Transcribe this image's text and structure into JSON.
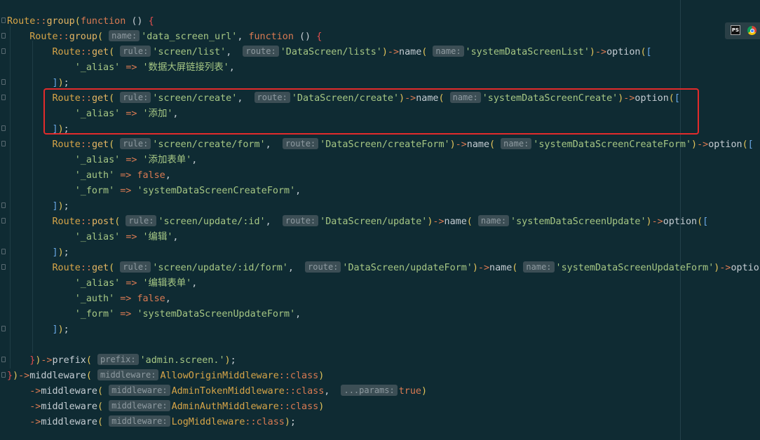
{
  "code": {
    "l1": {
      "a": "Route",
      "b": "::",
      "c": "group",
      "d": "function",
      "e": " () "
    },
    "l2": {
      "a": "Route",
      "b": "::",
      "c": "group",
      "hint": "name:",
      "s1": "'data_screen_url'",
      "d": "function",
      "e": " () "
    },
    "l3": {
      "a": "Route",
      "b": "::",
      "c": "get",
      "h1": "rule:",
      "s1": "'screen/list'",
      "h2": "route:",
      "s2": "'DataScreen/lists'",
      "m": "name",
      "h3": "name:",
      "s3": "'systemDataScreenList'",
      "o": "option"
    },
    "l4": {
      "k": "'_alias'",
      "arrow": "=>",
      "v": "'数据大屏链接列表'"
    },
    "l5": {
      "end": ";"
    },
    "l6": {
      "a": "Route",
      "b": "::",
      "c": "get",
      "h1": "rule:",
      "s1": "'screen/create'",
      "h2": "route:",
      "s2": "'DataScreen/create'",
      "m": "name",
      "h3": "name:",
      "s3": "'systemDataScreenCreate'",
      "o": "option"
    },
    "l7": {
      "k": "'_alias'",
      "arrow": "=>",
      "v": "'添加'"
    },
    "l9": {
      "a": "Route",
      "b": "::",
      "c": "get",
      "h1": "rule:",
      "s1": "'screen/create/form'",
      "h2": "route:",
      "s2": "'DataScreen/createForm'",
      "m": "name",
      "h3": "name:",
      "s3": "'systemDataScreenCreateForm'",
      "o": "option"
    },
    "l10": {
      "k": "'_alias'",
      "arrow": "=>",
      "v": "'添加表单'"
    },
    "l11": {
      "k": "'_auth'",
      "arrow": "=>",
      "v": "false"
    },
    "l12": {
      "k": "'_form'",
      "arrow": "=>",
      "v": "'systemDataScreenCreateForm'"
    },
    "l14": {
      "a": "Route",
      "b": "::",
      "c": "post",
      "h1": "rule:",
      "s1": "'screen/update/:id'",
      "h2": "route:",
      "s2": "'DataScreen/update'",
      "m": "name",
      "h3": "name:",
      "s3": "'systemDataScreenUpdate'",
      "o": "option"
    },
    "l15": {
      "k": "'_alias'",
      "arrow": "=>",
      "v": "'编辑'"
    },
    "l17": {
      "a": "Route",
      "b": "::",
      "c": "get",
      "h1": "rule:",
      "s1": "'screen/update/:id/form'",
      "h2": "route:",
      "s2": "'DataScreen/updateForm'",
      "m": "name",
      "h3": "name:",
      "s3": "'systemDataScreenUpdateForm'",
      "o": "option"
    },
    "l18": {
      "k": "'_alias'",
      "arrow": "=>",
      "v": "'编辑表单'"
    },
    "l19": {
      "k": "'_auth'",
      "arrow": "=>",
      "v": "false"
    },
    "l20": {
      "k": "'_form'",
      "arrow": "=>",
      "v": "'systemDataScreenUpdateForm'"
    },
    "l23": {
      "m": "prefix",
      "h": "prefix:",
      "s": "'admin.screen.'"
    },
    "l24": {
      "m": "middleware",
      "h": "middleware:",
      "c": "AllowOriginMiddleware",
      "d": "class"
    },
    "l25": {
      "m": "middleware",
      "h": "middleware:",
      "c": "AdminTokenMiddleware",
      "d": "class",
      "h2": "...params:",
      "v": "true"
    },
    "l26": {
      "m": "middleware",
      "h": "middleware:",
      "c": "AdminAuthMiddleware",
      "d": "class"
    },
    "l27": {
      "m": "middleware",
      "h": "middleware:",
      "c": "LogMiddleware",
      "d": "class"
    }
  },
  "side_icons": {
    "ps": "PS"
  },
  "colors": {
    "background": "#0f2b33",
    "highlight": "#e22b2b",
    "string": "#a6c784",
    "keyword": "#d97a52",
    "class": "#d7a548"
  }
}
